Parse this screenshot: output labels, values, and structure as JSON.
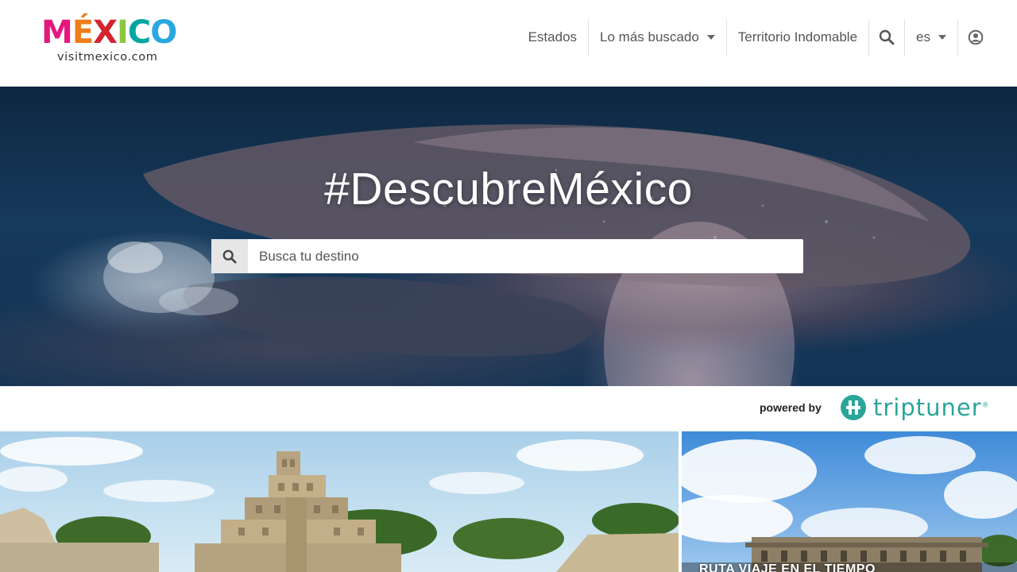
{
  "header": {
    "logo": {
      "letters": [
        {
          "char": "M",
          "color": "#e5177e"
        },
        {
          "char": "É",
          "color": "#ef7d1b"
        },
        {
          "char": "X",
          "color": "#d5232f"
        },
        {
          "char": "I",
          "color": "#8cc63f"
        },
        {
          "char": "C",
          "color": "#00a5a0"
        },
        {
          "char": "O",
          "color": "#29a8e0"
        }
      ],
      "subtitle": "visitmexico.com"
    },
    "nav": {
      "estados": "Estados",
      "lo_mas_buscado": "Lo más buscado",
      "territorio": "Territorio Indomable",
      "search_icon": "search-icon",
      "language": "es",
      "user_icon": "user-icon"
    }
  },
  "hero": {
    "title": "#DescubreMéxico",
    "search": {
      "placeholder": "Busca tu destino",
      "value": "",
      "icon": "search-icon"
    }
  },
  "powered": {
    "label": "powered by",
    "brand": "triptuner",
    "reg": "®",
    "brand_color": "#2aa59a"
  },
  "cards": [
    {
      "caption": ""
    },
    {
      "caption": "RUTA VIAJE EN EL TIEMPO"
    }
  ],
  "colors": {
    "accent": "#2aa59a",
    "nav_text": "#555555",
    "search_button_bg": "#e6e6e6"
  }
}
